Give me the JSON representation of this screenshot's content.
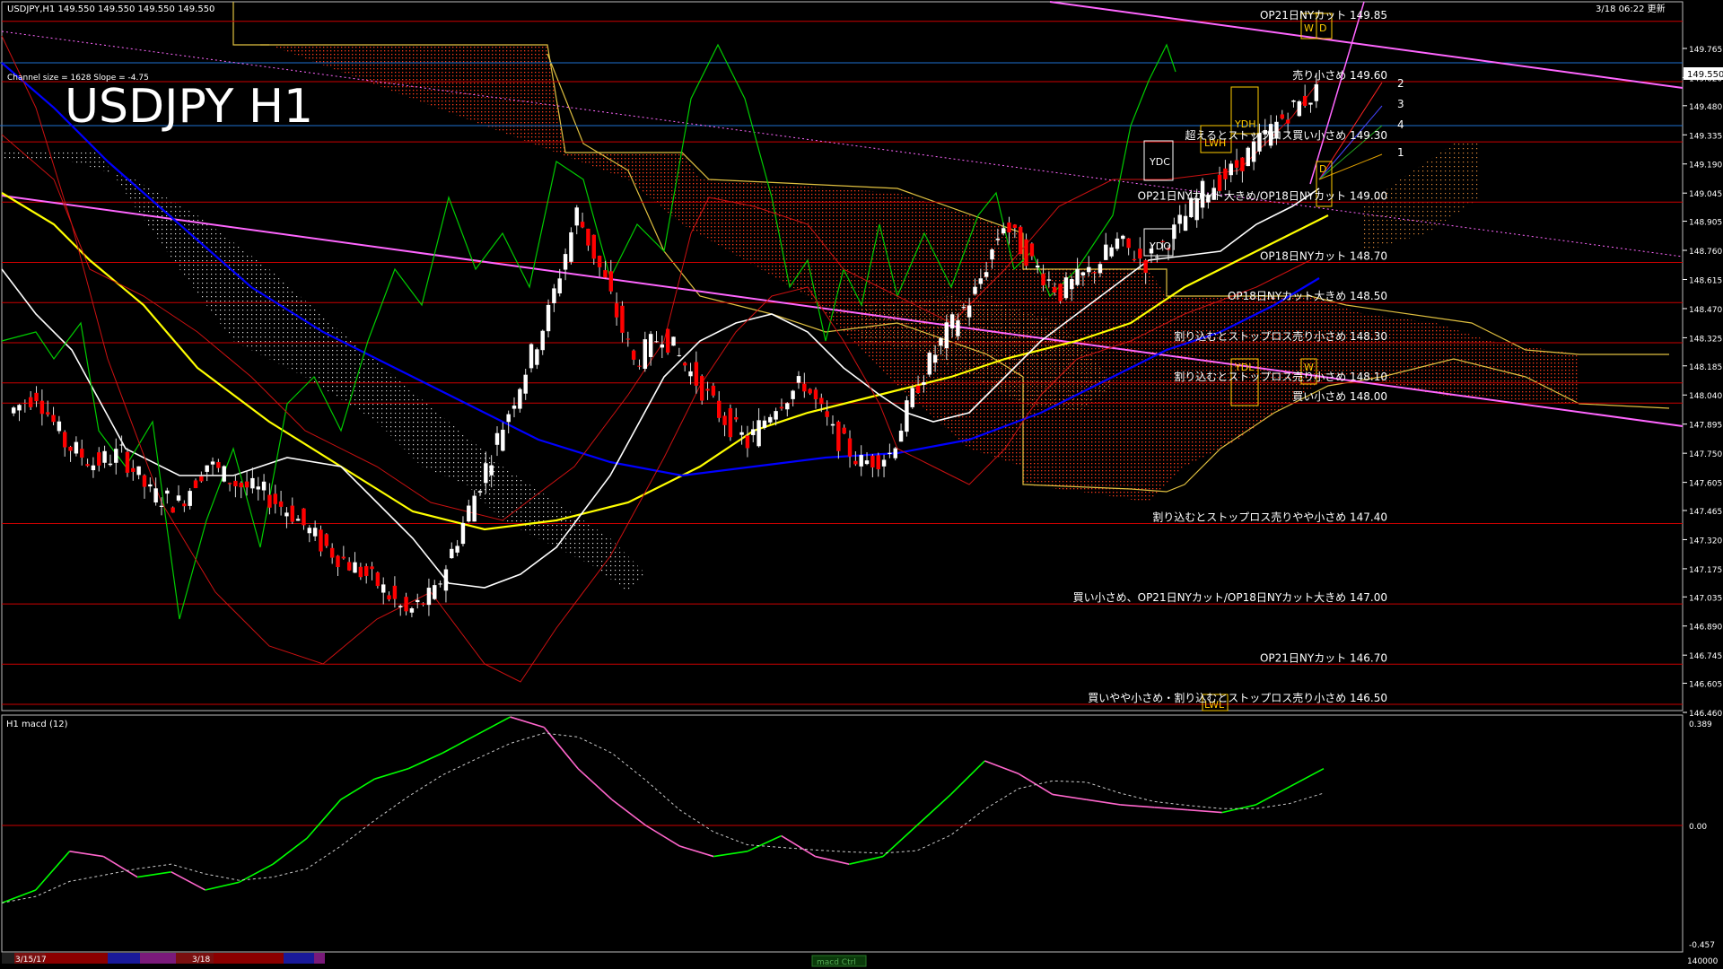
{
  "header": {
    "ohlc_text": "USDJPY,H1  149.550 149.550 149.550 149.550",
    "updated_text": "3/18 06:22 更新",
    "symbol_title": "USDJPY H1",
    "channel_info": "Channel size = 1628 Slope = -4.75"
  },
  "price_axis": {
    "ticks": [
      "149.765",
      "149.620",
      "149.480",
      "149.335",
      "149.190",
      "149.045",
      "148.905",
      "148.760",
      "148.615",
      "148.470",
      "148.325",
      "148.185",
      "148.040",
      "147.895",
      "147.750",
      "147.605",
      "147.465",
      "147.320",
      "147.175",
      "147.035",
      "146.890",
      "146.745",
      "146.605",
      "146.460"
    ],
    "current_price": "149.550"
  },
  "levels": [
    {
      "price": 149.9,
      "label": "OP21日NYカット 149.85"
    },
    {
      "price": 149.6,
      "label": "売り小さめ 149.60"
    },
    {
      "price": 149.3,
      "label": "超えるとストップロス買い小さめ 149.30"
    },
    {
      "price": 149.0,
      "label": "OP21日NYカット大きめ/OP18日NYカット 149.00"
    },
    {
      "price": 148.7,
      "label": "OP18日NYカット 148.70"
    },
    {
      "price": 148.5,
      "label": "OP18日NYカット大きめ 148.50"
    },
    {
      "price": 148.3,
      "label": "割り込むとストップロス売り小さめ 148.30"
    },
    {
      "price": 148.1,
      "label": "割り込むとストップロス売り小さめ 148.10"
    },
    {
      "price": 148.0,
      "label": "買い小さめ 148.00"
    },
    {
      "price": 147.4,
      "label": "割り込むとストップロス売りやや小さめ 147.40"
    },
    {
      "price": 147.0,
      "label": "買い小さめ、OP21日NYカット/OP18日NYカット大きめ 147.00"
    },
    {
      "price": 146.7,
      "label": "OP21日NYカット 146.70"
    },
    {
      "price": 146.5,
      "label": "買いやや小さめ・割り込むとストップロス売り小さめ 146.50"
    }
  ],
  "markers": {
    "ydc": "YDC",
    "ydo": "YDO",
    "ydh": "YDH",
    "ydl": "YDL",
    "lwh": "LWH",
    "lwl": "LWL",
    "w": "W",
    "d": "D",
    "fan": [
      "2",
      "3",
      "4",
      "1"
    ]
  },
  "macd": {
    "title": "H1  macd (12)",
    "ticks": [
      "0.389",
      "0.00",
      "-0.457"
    ],
    "bottom_value": "140000",
    "button_label": "macd Ctrl",
    "dates": [
      "3/15/17",
      "3/18"
    ]
  },
  "colors": {
    "bull_candle": "#ffffff",
    "bear_candle": "#ff0000",
    "ma_white": "#ffffff",
    "ma_yellow": "#ffff00",
    "ma_blue": "#0000ff",
    "channel": "#ff66ff",
    "level_line": "#cc0000",
    "macd_up": "#00ff00",
    "macd_down": "#ff66cc"
  },
  "chart_data": {
    "type": "line",
    "symbol": "USDJPY",
    "timeframe": "H1",
    "ylim": [
      146.46,
      149.83
    ],
    "series": [
      {
        "name": "USDJPY H1",
        "values": [
          147.95,
          148.05,
          147.8,
          147.7,
          147.75,
          147.55,
          147.5,
          147.7,
          147.6,
          147.55,
          147.45,
          147.3,
          147.2,
          147.1,
          146.95,
          147.05,
          147.4,
          147.75,
          148.1,
          148.45,
          148.95,
          148.6,
          148.2,
          148.35,
          148.15,
          147.95,
          147.8,
          148.0,
          148.1,
          147.85,
          147.7,
          147.75,
          148.1,
          148.35,
          148.55,
          148.9,
          148.7,
          148.55,
          148.65,
          148.8,
          148.7,
          148.85,
          149.05,
          149.15,
          149.3,
          149.45,
          149.55
        ]
      },
      {
        "name": "macd (12)",
        "values": [
          -0.3,
          -0.25,
          -0.1,
          -0.12,
          -0.2,
          -0.18,
          -0.25,
          -0.22,
          -0.15,
          -0.05,
          0.1,
          0.18,
          0.22,
          0.28,
          0.35,
          0.42,
          0.38,
          0.22,
          0.1,
          0.0,
          -0.08,
          -0.12,
          -0.1,
          -0.04,
          -0.12,
          -0.15,
          -0.12,
          0.0,
          0.12,
          0.25,
          0.2,
          0.12,
          0.1,
          0.08,
          0.07,
          0.06,
          0.05,
          0.08,
          0.15,
          0.22
        ]
      }
    ]
  }
}
